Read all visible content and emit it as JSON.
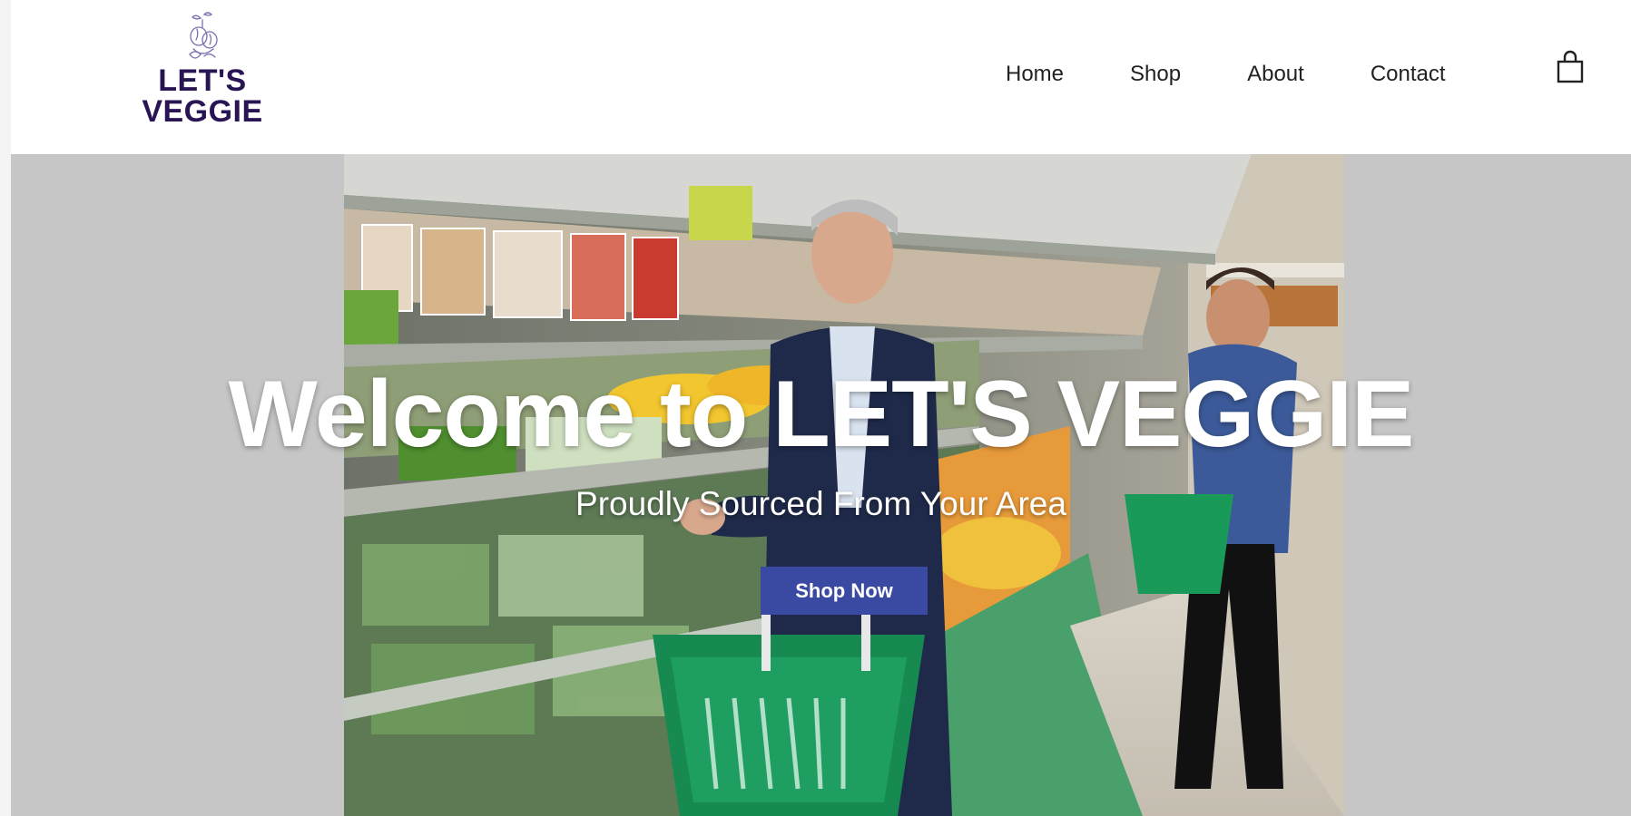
{
  "brand": {
    "name_line1": "LET'S",
    "name_line2": "VEGGIE",
    "color": "#2a1554"
  },
  "nav": {
    "items": [
      "Home",
      "Shop",
      "About",
      "Contact"
    ],
    "cart_icon": "shopping-bag-icon"
  },
  "hero": {
    "title": "Welcome to LET'S VEGGIE",
    "subtitle": "Proudly Sourced From Your Area",
    "cta_label": "Shop Now",
    "cta_color": "#3a4aa3",
    "background_color": "#c6c6c6"
  }
}
